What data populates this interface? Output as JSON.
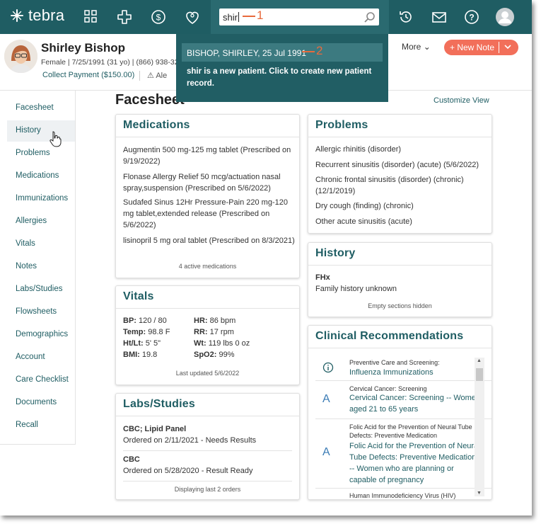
{
  "topbar": {
    "logo": "tebra",
    "search_value": "shir"
  },
  "callouts": {
    "one": "1",
    "two": "2"
  },
  "search_dropdown": {
    "result": "BISHOP, SHIRLEY, 25 Jul 1991",
    "new_patient_note": "shir is a new patient. Click to create new patient record."
  },
  "patient": {
    "name": "Shirley Bishop",
    "info": "Female | 7/25/1991 (31 yo) | (866) 938-32",
    "collect_payment": "Collect Payment ($150.00)",
    "alerts_label": "Ale"
  },
  "actions": {
    "more": "More",
    "new_note": "+ New Note"
  },
  "sidebar": {
    "items": [
      "Facesheet",
      "History",
      "Problems",
      "Medications",
      "Immunizations",
      "Allergies",
      "Vitals",
      "Notes",
      "Labs/Studies",
      "Flowsheets",
      "Demographics",
      "Account",
      "Care Checklist",
      "Documents",
      "Recall"
    ]
  },
  "page": {
    "title": "Facesheet",
    "customize": "Customize View"
  },
  "medications": {
    "title": "Medications",
    "items": [
      "Augmentin 500 mg-125 mg tablet (Prescribed on 9/19/2022)",
      "Flonase Allergy Relief 50 mcg/actuation nasal spray,suspension (Prescribed on 5/6/2022)",
      "Sudafed Sinus 12Hr Pressure-Pain 220 mg-120 mg tablet,extended release (Prescribed on 5/6/2022)",
      "lisinopril 5 mg oral tablet (Prescribed on 8/3/2021)"
    ],
    "footer": "4 active medications"
  },
  "vitals": {
    "title": "Vitals",
    "left": [
      {
        "label": "BP:",
        "value": "120 / 80"
      },
      {
        "label": "Temp:",
        "value": "98.8 F"
      },
      {
        "label": "Ht/Lt:",
        "value": "5' 5\""
      },
      {
        "label": "BMI:",
        "value": "19.8"
      }
    ],
    "right": [
      {
        "label": "HR:",
        "value": "86 bpm"
      },
      {
        "label": "RR:",
        "value": "17 rpm"
      },
      {
        "label": "Wt:",
        "value": "119 lbs 0 oz"
      },
      {
        "label": "SpO2:",
        "value": "99%"
      }
    ],
    "footer": "Last updated 5/6/2022"
  },
  "labs": {
    "title": "Labs/Studies",
    "items": [
      {
        "name": "CBC; Lipid Panel",
        "detail": "Ordered on 2/11/2021 - Needs Results"
      },
      {
        "name": "CBC",
        "detail": "Ordered on 5/28/2020 - Result Ready"
      }
    ],
    "footer": "Displaying last 2 orders"
  },
  "problems": {
    "title": "Problems",
    "items": [
      "Allergic rhinitis (disorder)",
      "Recurrent sinusitis (disorder) (acute) (5/6/2022)",
      "Chronic frontal sinusitis (disorder) (chronic) (12/1/2019)",
      "Dry cough (finding) (chronic)",
      "Other acute sinusitis (acute)"
    ]
  },
  "history": {
    "title": "History",
    "label": "FHx",
    "value": "Family history unknown",
    "footer": "Empty sections hidden"
  },
  "recommendations": {
    "title": "Clinical Recommendations",
    "items": [
      {
        "icon": "info-icon",
        "category": "Preventive Care and Screening:",
        "link": "Influenza Immunizations"
      },
      {
        "icon": "A",
        "category": "Cervical Cancer: Screening",
        "link": "Cervical Cancer: Screening -- Women aged 21 to 65 years"
      },
      {
        "icon": "A",
        "category": "Folic Acid for the Prevention of Neural Tube Defects: Preventive Medication",
        "link": "Folic Acid for the Prevention of Neural Tube Defects: Preventive Medication -- Women who are planning or capable of pregnancy"
      },
      {
        "icon": "",
        "category": "Human Immunodeficiency Virus (HIV)",
        "link": ""
      }
    ]
  },
  "colors": {
    "primary": "#1f5d63",
    "accent": "#f26f5a",
    "callout": "#e86a3c"
  }
}
